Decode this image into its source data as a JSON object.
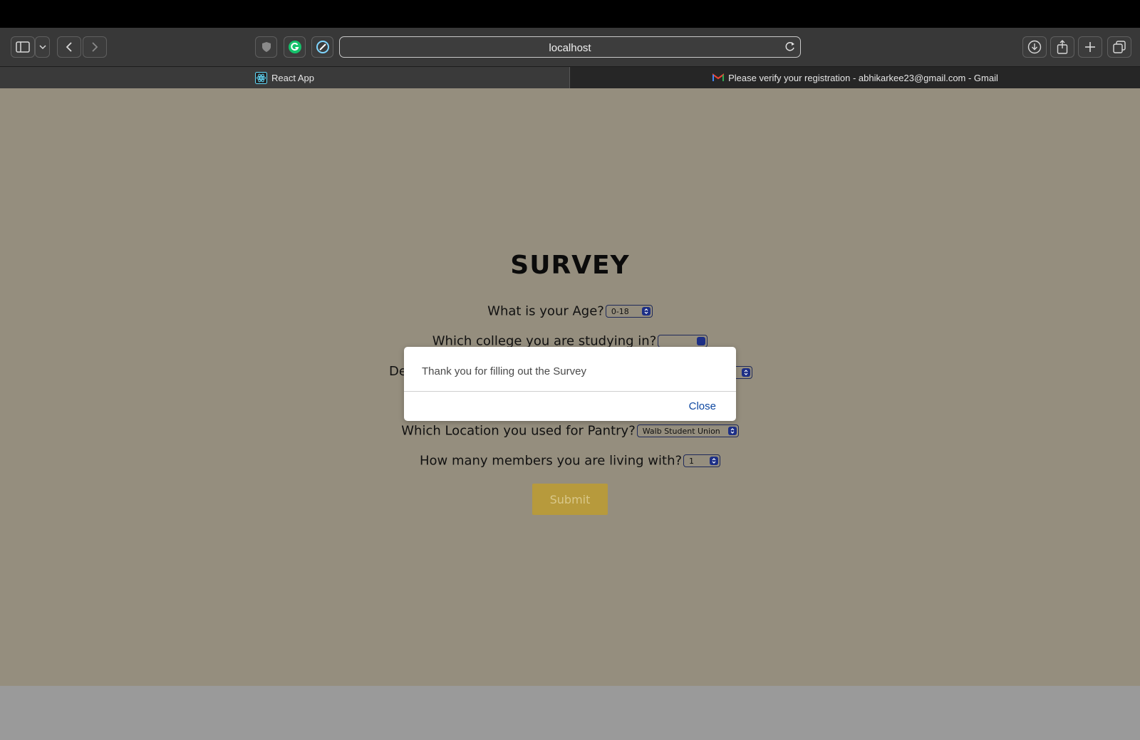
{
  "browser": {
    "url": "localhost",
    "tabs": [
      {
        "label": "React App",
        "icon": "react-icon"
      },
      {
        "label": "Please verify your registration - abhikarkee23@gmail.com - Gmail",
        "icon": "gmail-icon"
      }
    ]
  },
  "survey": {
    "title": "SURVEY",
    "questions": [
      {
        "label": "What is your Age?",
        "selected": "0-18"
      },
      {
        "label": "Which college you are studying in?"
      },
      {
        "label_fragment": "De"
      },
      {
        "label": "Which Location you used for Pantry?",
        "selected": "Walb Student Union"
      },
      {
        "label": "How many members you are living with?",
        "selected": "1"
      }
    ],
    "submit_label": "Submit"
  },
  "modal": {
    "message": "Thank you for filling out the Survey",
    "close_label": "Close"
  }
}
